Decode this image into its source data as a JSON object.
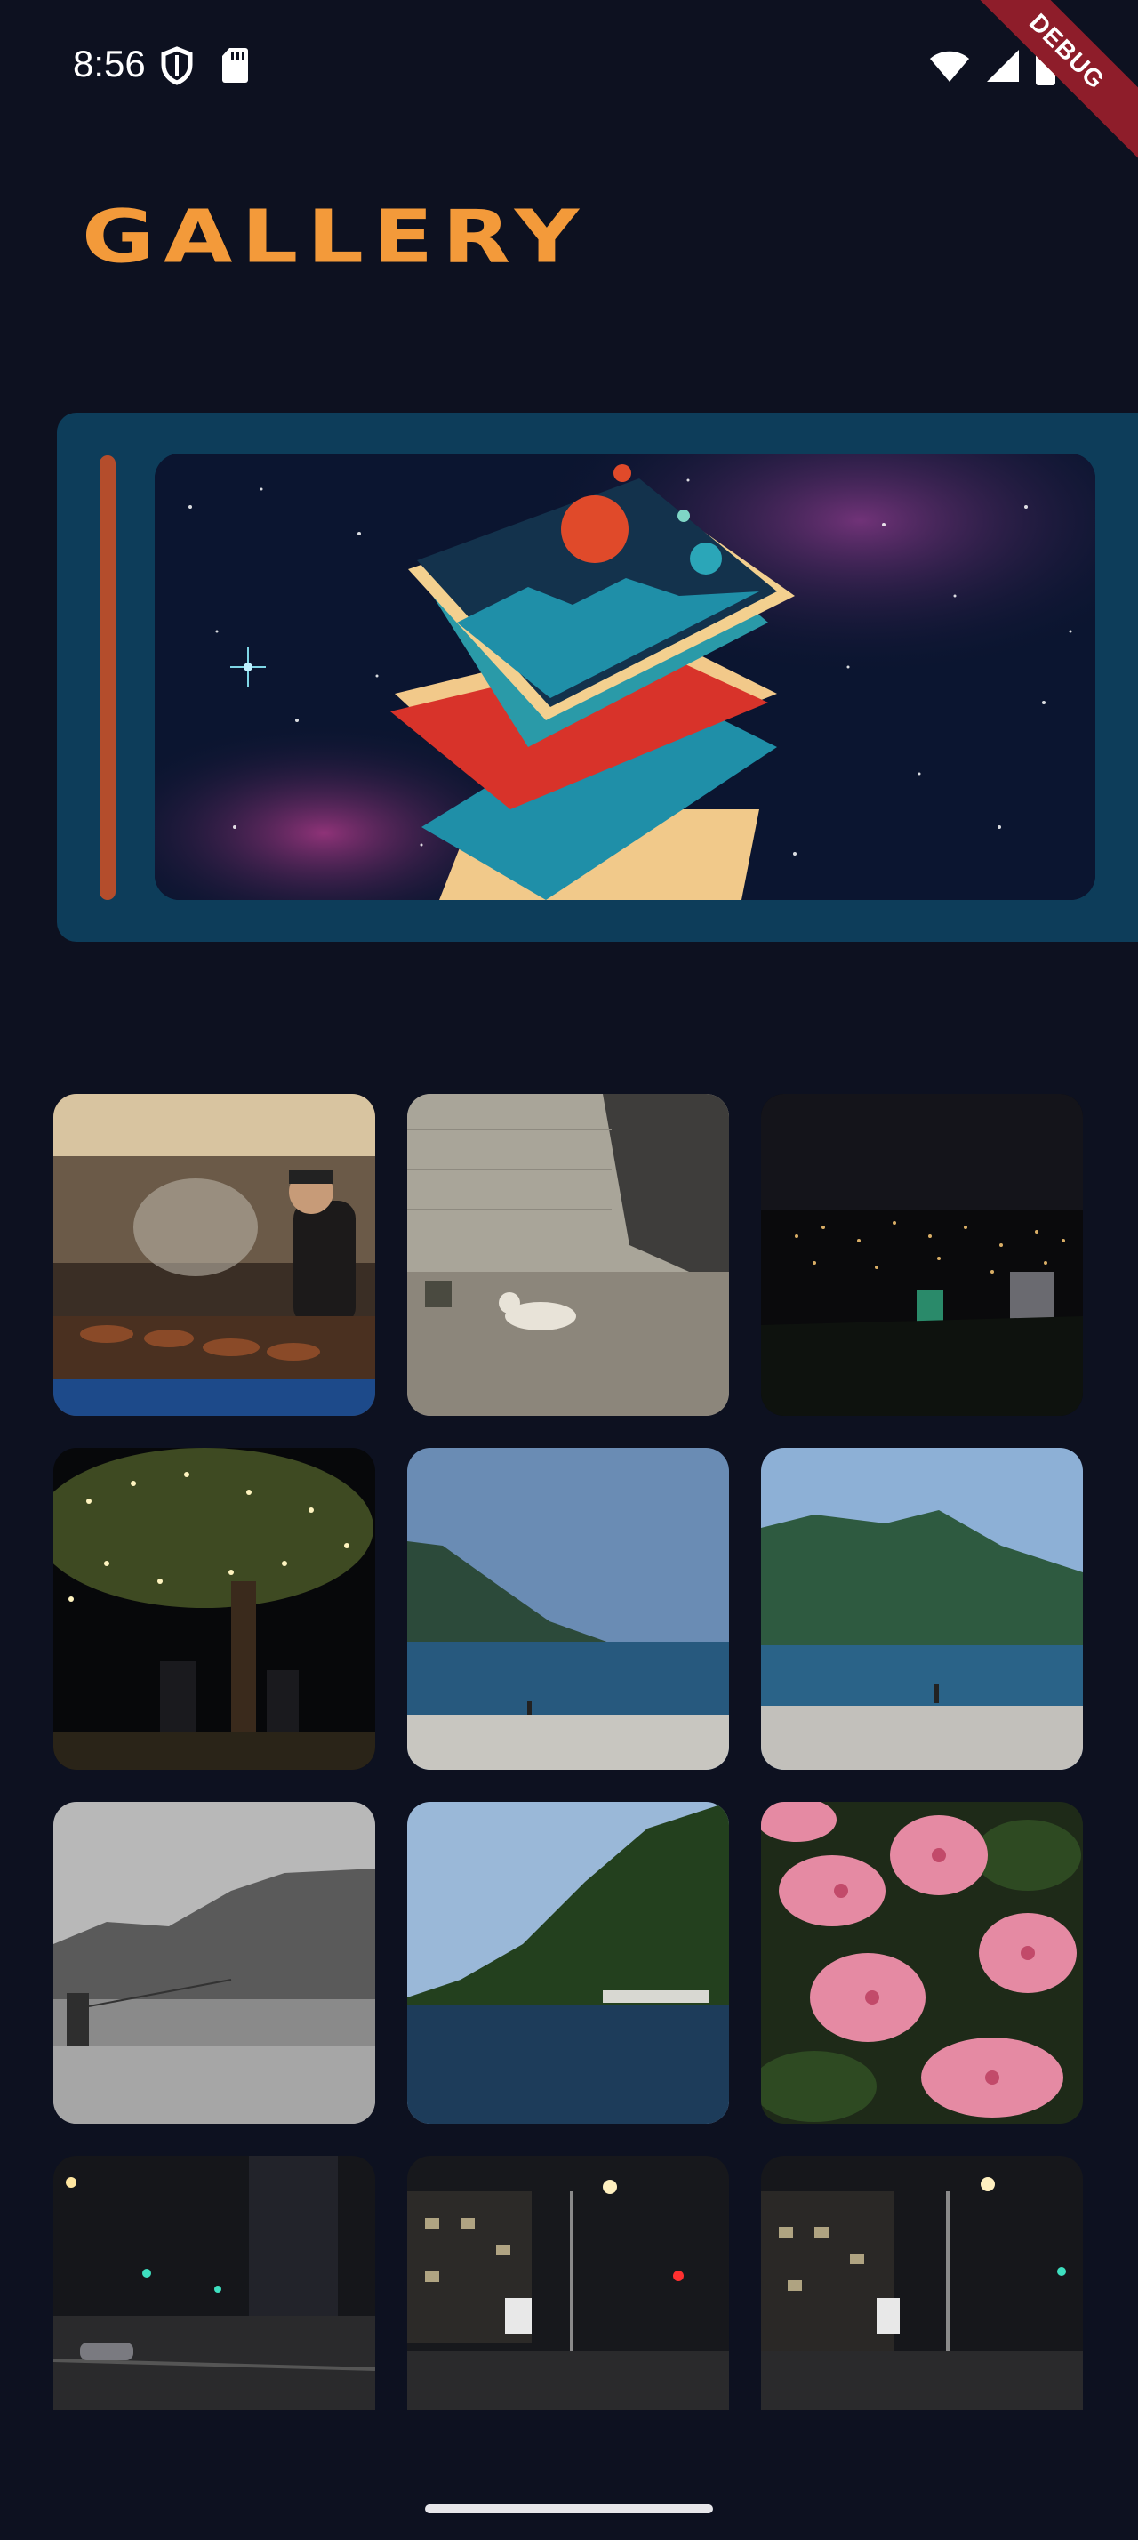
{
  "status_bar": {
    "time": "8:56",
    "left_icons": [
      "shield-icon",
      "sd-card-icon"
    ],
    "right_icons": [
      "wifi-icon",
      "signal-icon",
      "battery-icon"
    ]
  },
  "debug_banner": "DEBUG",
  "app": {
    "title": "GALLERY"
  },
  "hero": {
    "image": "stacked-photos-in-space-illustration"
  },
  "grid": {
    "photos": [
      "street-food-vendor",
      "cat-lying-by-wall",
      "city-lights-at-night",
      "lit-tree-at-night",
      "coast-and-beach",
      "mountain-beach-with-fisher",
      "grayscale-beach-fisher",
      "green-hill-over-sea",
      "pink-azalea-flowers",
      "night-street-intersection",
      "night-street-red-light",
      "night-street-lamps"
    ]
  },
  "colors": {
    "background": "#0d1120",
    "title": "#f39a3a",
    "hero_card": "#0d3d5a",
    "hero_accent": "#b44d2c"
  }
}
